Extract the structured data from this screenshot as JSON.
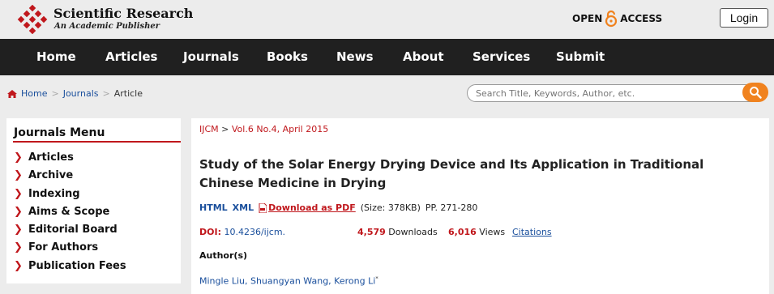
{
  "header": {
    "logo_title": "Scientific Research",
    "logo_subtitle": "An Academic Publisher",
    "open_access_left": "OPEN",
    "open_access_right": "ACCESS",
    "login_label": "Login",
    "brand_color": "#c0171c",
    "accent_color": "#f0821e"
  },
  "nav": {
    "items": [
      "Home",
      "Articles",
      "Journals",
      "Books",
      "News",
      "About",
      "Services",
      "Submit"
    ]
  },
  "breadcrumb": {
    "home": "Home",
    "journals": "Journals",
    "current": "Article",
    "separator": ">"
  },
  "search": {
    "placeholder": "Search Title, Keywords, Author, etc."
  },
  "sidebar": {
    "title": "Journals Menu",
    "items": [
      "Articles",
      "Archive",
      "Indexing",
      "Aims & Scope",
      "Editorial Board",
      "For Authors",
      "Publication Fees"
    ]
  },
  "article": {
    "journal": "IJCM",
    "issue": "Vol.6 No.4, April 2015",
    "title": "Study of the Solar Energy Drying Device and Its Application in Traditional Chinese Medicine in Drying",
    "format_html": "HTML",
    "format_xml": "XML",
    "pdf_label": "Download as PDF",
    "size_text": "(Size: 378KB)",
    "pages": "PP. 271-280",
    "doi_label": "DOI:",
    "doi": "10.4236/ijcm.",
    "downloads_count": "4,579",
    "downloads_label": "Downloads",
    "views_count": "6,016",
    "views_label": "Views",
    "citations_label": "Citations",
    "authors_heading": "Author(s)",
    "authors": "Mingle Liu, Shuangyan Wang, Kerong Li",
    "author_mark": "*"
  }
}
